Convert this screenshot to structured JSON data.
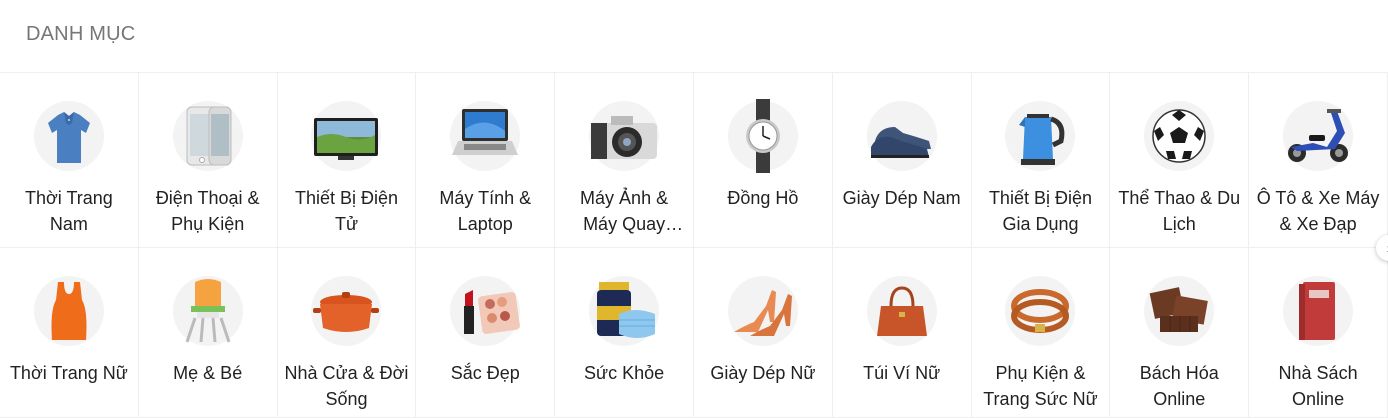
{
  "header": {
    "title": "DANH MỤC"
  },
  "categories": [
    {
      "label": "Thời Trang Nam",
      "icon": "polo-shirt-icon"
    },
    {
      "label": "Điện Thoại & Phụ Kiện",
      "icon": "smartphone-icon"
    },
    {
      "label": "Thiết Bị Điện Tử",
      "icon": "television-icon"
    },
    {
      "label": "Máy Tính & Laptop",
      "icon": "laptop-icon"
    },
    {
      "label": "Máy Ảnh & Máy Quay Phim",
      "icon": "camera-icon"
    },
    {
      "label": "Đồng Hồ",
      "icon": "wristwatch-icon"
    },
    {
      "label": "Giày Dép Nam",
      "icon": "men-shoe-icon"
    },
    {
      "label": "Thiết Bị Điện Gia Dụng",
      "icon": "electric-kettle-icon"
    },
    {
      "label": "Thể Thao & Du Lịch",
      "icon": "soccer-ball-icon"
    },
    {
      "label": "Ô Tô & Xe Máy & Xe Đạp",
      "icon": "scooter-icon"
    },
    {
      "label": "Thời Trang Nữ",
      "icon": "tank-top-icon"
    },
    {
      "label": "Mẹ & Bé",
      "icon": "baby-high-chair-icon"
    },
    {
      "label": "Nhà Cửa & Đời Sống",
      "icon": "cooking-pot-icon"
    },
    {
      "label": "Sắc Đẹp",
      "icon": "makeup-palette-icon"
    },
    {
      "label": "Sức Khỏe",
      "icon": "vitamin-mask-icon"
    },
    {
      "label": "Giày Dép Nữ",
      "icon": "high-heels-icon"
    },
    {
      "label": "Túi Ví Nữ",
      "icon": "handbag-icon"
    },
    {
      "label": "Phụ Kiện & Trang Sức Nữ",
      "icon": "leather-bracelet-icon"
    },
    {
      "label": "Bách Hóa Online",
      "icon": "chocolate-icon"
    },
    {
      "label": "Nhà Sách Online",
      "icon": "book-icon"
    }
  ],
  "navigation": {
    "next_icon": "chevron-right-icon",
    "next_glyph": "›"
  }
}
